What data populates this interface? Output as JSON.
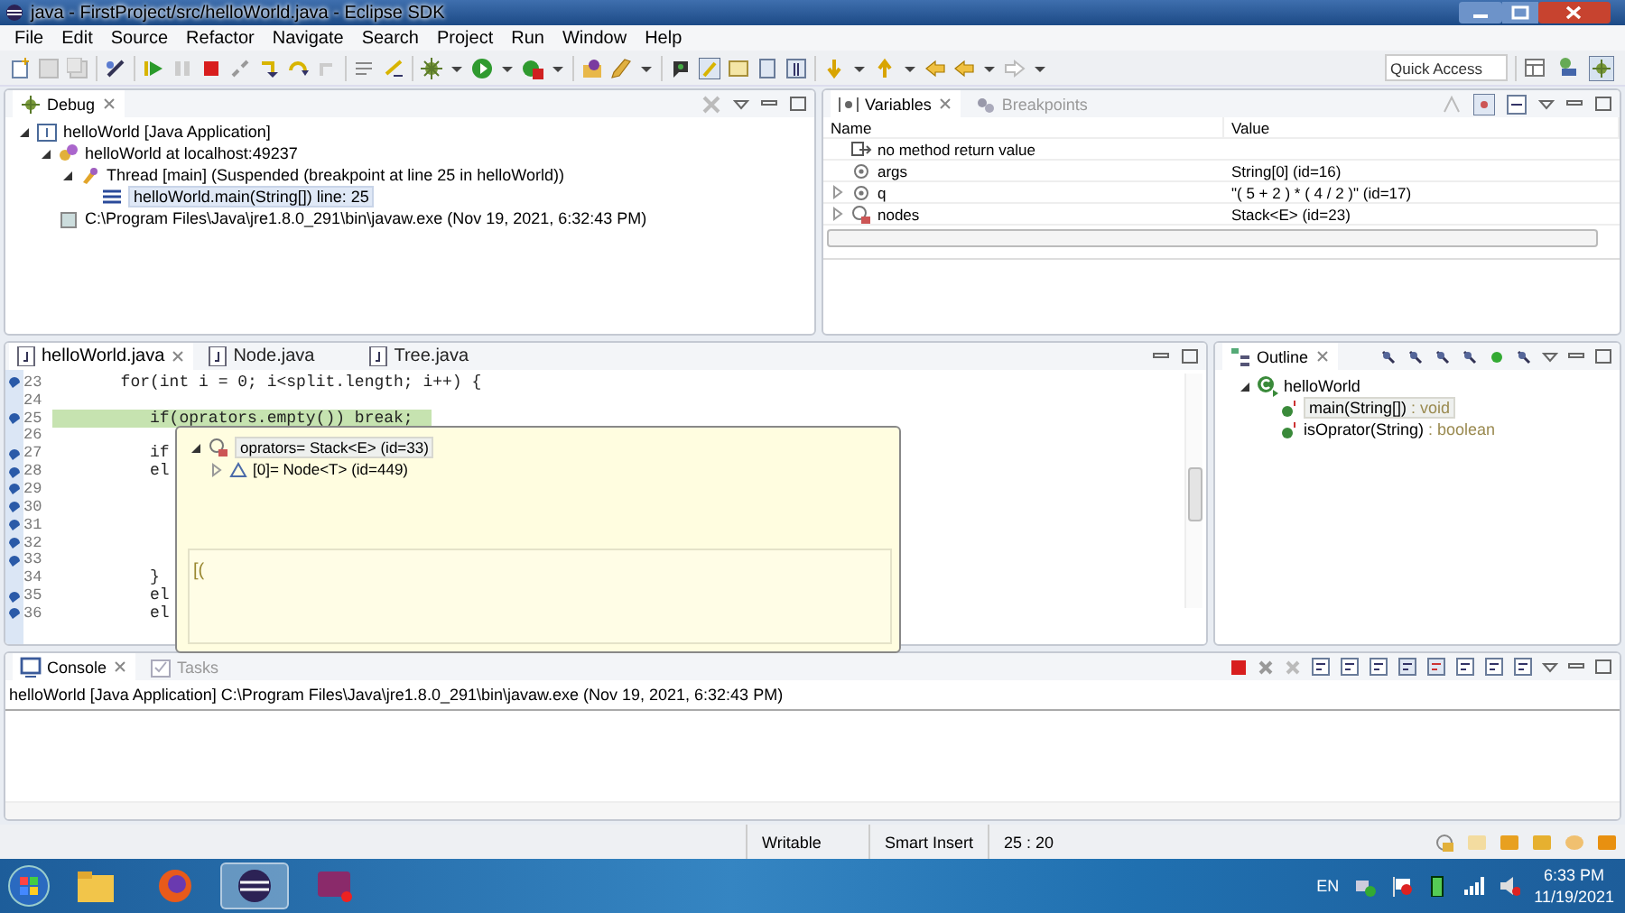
{
  "window": {
    "title": "java - FirstProject/src/helloWorld.java - Eclipse SDK"
  },
  "menu": [
    "File",
    "Edit",
    "Source",
    "Refactor",
    "Navigate",
    "Search",
    "Project",
    "Run",
    "Window",
    "Help"
  ],
  "toolbar": {
    "quick_access": {
      "placeholder": "Quick Access"
    }
  },
  "debug": {
    "tab": "Debug",
    "tree": [
      {
        "label": "helloWorld [Java Application]",
        "expanded": true,
        "children": [
          {
            "label": "helloWorld at localhost:49237",
            "expanded": true,
            "children": [
              {
                "label": "Thread [main] (Suspended (breakpoint at line 25 in helloWorld))",
                "expanded": true,
                "children": [
                  {
                    "label": "helloWorld.main(String[]) line: 25",
                    "selected": true
                  }
                ]
              }
            ]
          },
          {
            "label": "C:\\Program Files\\Java\\jre1.8.0_291\\bin\\javaw.exe (Nov 19, 2021, 6:32:43 PM)"
          }
        ]
      }
    ]
  },
  "variables": {
    "tabs": [
      {
        "label": "Variables",
        "selected": true
      },
      {
        "label": "Breakpoints",
        "selected": false
      }
    ],
    "columns": [
      "Name",
      "Value"
    ],
    "rows": [
      {
        "name": "no method return value"
      },
      {
        "name": "args",
        "value": "String[0]  (id=16)"
      },
      {
        "name": "q",
        "value": "\"( 5 + 2 ) * ( 4 / 2 )\" (id=17)",
        "expanded": false
      },
      {
        "name": "nodes",
        "value": "Stack<E>  (id=23)",
        "expanded": false
      }
    ]
  },
  "editor": {
    "tabs": [
      {
        "label": "helloWorld.java",
        "selected": true
      },
      {
        "label": "Node.java",
        "selected": false
      },
      {
        "label": "Tree.java",
        "selected": false
      }
    ],
    "lines": [
      {
        "number": "23",
        "text": "       for(int i = 0; i<split.length; i++) {",
        "marker": true,
        "current": false
      },
      {
        "number": "24",
        "marker": false,
        "current": false
      },
      {
        "number": "25",
        "text": "          if(oprators.empty()) break;",
        "marker": true,
        "current": true
      },
      {
        "number": "26",
        "marker": false,
        "current": false
      },
      {
        "number": "27",
        "text": "          if",
        "marker": true,
        "current": false
      },
      {
        "number": "28",
        "text": "          el",
        "marker": true,
        "current": false
      },
      {
        "number": "29",
        "marker": true,
        "current": false
      },
      {
        "number": "30",
        "marker": true,
        "current": false
      },
      {
        "number": "31",
        "marker": true,
        "current": false
      },
      {
        "number": "32",
        "marker": true,
        "current": false
      },
      {
        "number": "33",
        "marker": true,
        "current": false
      },
      {
        "number": "34",
        "text": "          }",
        "marker": false,
        "current": false
      },
      {
        "number": "35",
        "text": "          el",
        "marker": true,
        "current": false
      },
      {
        "number": "36",
        "text": "          el",
        "marker": true,
        "current": false
      }
    ],
    "popup": {
      "tree": [
        {
          "label": "oprators= Stack<E>  (id=33)",
          "expanded": true,
          "children": [
            {
              "label": "[0]= Node<T>  (id=449)",
              "expanded": false
            }
          ]
        }
      ],
      "detail": "[("
    }
  },
  "outline": {
    "tab": "Outline",
    "tree": [
      {
        "label": "helloWorld",
        "expanded": true,
        "children": [
          {
            "label": "main(String[])",
            "type": " : void",
            "selected": true
          },
          {
            "label": "isOprator(String)",
            "type": " : boolean",
            "selected": false
          }
        ]
      }
    ]
  },
  "console": {
    "tabs": [
      {
        "label": "Console",
        "selected": true
      },
      {
        "label": "Tasks",
        "selected": false
      }
    ],
    "text": "helloWorld [Java Application] C:\\Program Files\\Java\\jre1.8.0_291\\bin\\javaw.exe (Nov 19, 2021, 6:32:43 PM)"
  },
  "status_bar": [
    "Writable",
    "Smart Insert",
    "25 : 20"
  ],
  "taskbar": {
    "language": "EN",
    "time": "6:33 PM",
    "date": "11/19/2021"
  }
}
